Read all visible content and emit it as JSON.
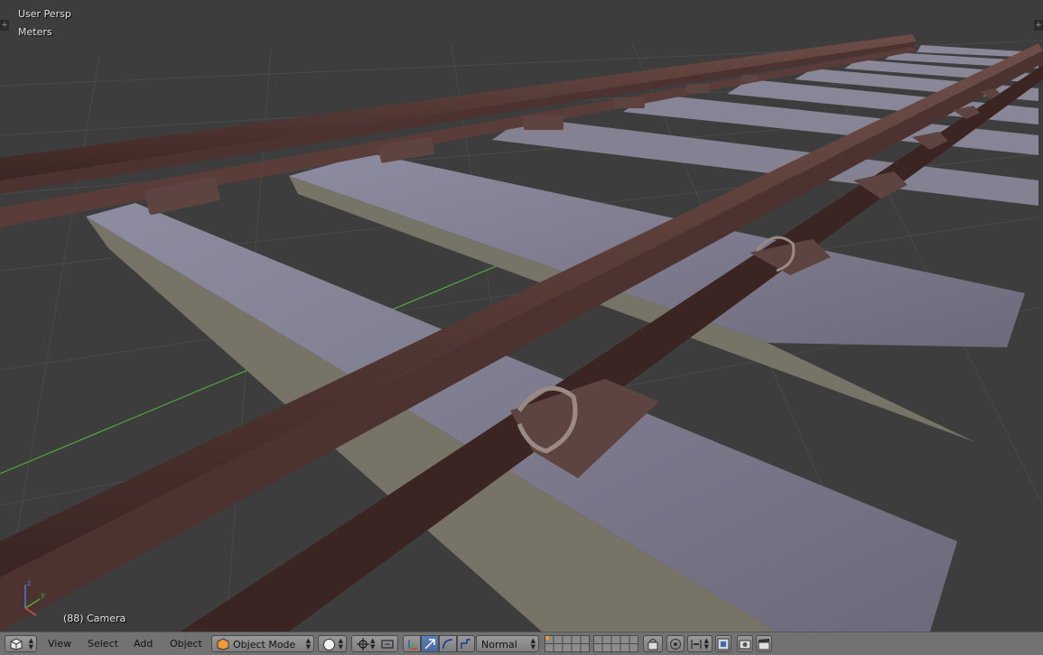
{
  "viewport": {
    "view_name": "User Persp",
    "units": "Meters",
    "object_info": "(88) Camera",
    "axes": {
      "z": "z",
      "y": "y"
    }
  },
  "header": {
    "menus": [
      {
        "label": "View"
      },
      {
        "label": "Select"
      },
      {
        "label": "Add"
      },
      {
        "label": "Object"
      }
    ],
    "mode": "Object Mode",
    "orientation": "Normal",
    "icons": {
      "editor_type": "cube-icon",
      "shading": "solid-sphere-icon",
      "pivot": "pivot-icon",
      "manipulator": "manipulator-icon",
      "translate": "translate-arrow-icon",
      "rotate": "rotate-icon",
      "scale": "scale-icon",
      "layers": "layers-grid-icon",
      "lock": "lock-camera-icon",
      "proportional": "proportional-edit-icon",
      "snap": "snap-icon",
      "snap_target": "snap-target-icon",
      "render": "render-icon",
      "clapper": "clapper-icon"
    },
    "colors": {
      "header_bg": "#727272",
      "active_button": "#5b7fb5",
      "viewport_bg": "#3d3d3d"
    }
  }
}
